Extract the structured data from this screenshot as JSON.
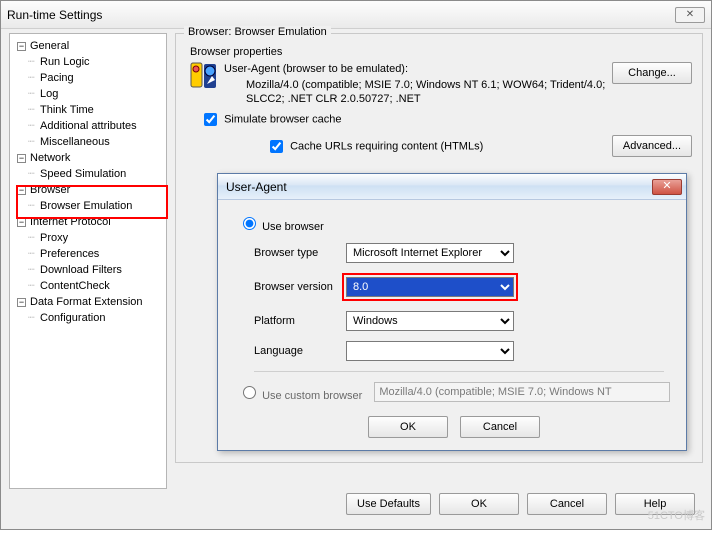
{
  "window": {
    "title": "Run-time Settings"
  },
  "tree": {
    "general": {
      "label": "General",
      "items": [
        "Run Logic",
        "Pacing",
        "Log",
        "Think Time",
        "Additional attributes",
        "Miscellaneous"
      ]
    },
    "network": {
      "label": "Network",
      "items": [
        "Speed Simulation"
      ]
    },
    "browser": {
      "label": "Browser",
      "items": [
        "Browser Emulation"
      ]
    },
    "internet": {
      "label": "Internet Protocol",
      "items": [
        "Proxy",
        "Preferences",
        "Download Filters",
        "ContentCheck"
      ]
    },
    "dataformat": {
      "label": "Data Format Extension",
      "items": [
        "Configuration"
      ]
    }
  },
  "panel": {
    "group_title": "Browser: Browser Emulation",
    "props_label": "Browser properties",
    "ua_label": "User-Agent (browser to be emulated):",
    "ua_value": "Mozilla/4.0 (compatible; MSIE 7.0; Windows NT 6.1; WOW64; Trident/4.0; SLCC2; .NET CLR 2.0.50727; .NET",
    "change_btn": "Change...",
    "simulate_label": "Simulate browser cache",
    "cache_label": "Cache URLs requiring content (HTMLs)",
    "advanced_btn": "Advanced..."
  },
  "modal": {
    "title": "User-Agent",
    "use_browser": "Use browser",
    "browser_type_lbl": "Browser type",
    "browser_type_val": "Microsoft Internet Explorer",
    "browser_ver_lbl": "Browser version",
    "browser_ver_val": "8.0",
    "platform_lbl": "Platform",
    "platform_val": "Windows",
    "language_lbl": "Language",
    "language_val": "",
    "custom_lbl": "Use custom browser",
    "custom_val": "Mozilla/4.0 (compatible; MSIE 7.0; Windows NT",
    "ok": "OK",
    "cancel": "Cancel"
  },
  "footer": {
    "use_defaults": "Use Defaults",
    "ok": "OK",
    "cancel": "Cancel",
    "help": "Help"
  },
  "watermark": "51CTO博客"
}
